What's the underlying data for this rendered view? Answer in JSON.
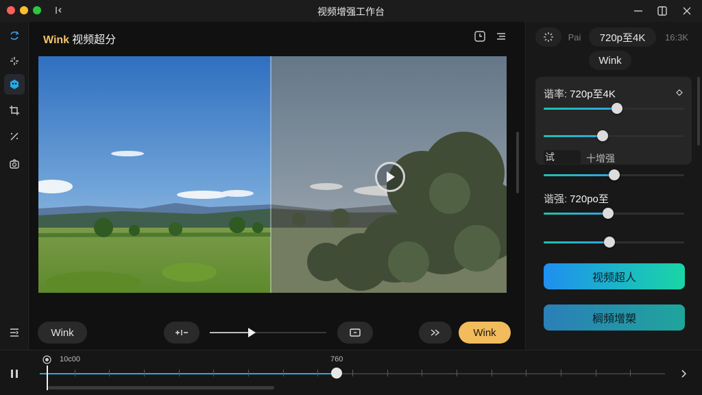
{
  "window": {
    "title": "视频增强工作台"
  },
  "preview": {
    "brand": "Wink",
    "title": "视频超分"
  },
  "controls": {
    "left_chip": "Wink",
    "zoom_label": "+|-",
    "progress_fraction": 0.36,
    "right_chip": "Wink"
  },
  "panel": {
    "chip_pro": "Pai",
    "chip_resolution": "720p至4K",
    "chip_ratio": "16:3K",
    "chip_wink": "Wink",
    "row1_label": "谐率:",
    "row1_value": "720p至4K",
    "slider1": 0.52,
    "slider2": 0.42,
    "seg_box": "试",
    "seg_text": "十增强",
    "slider3": 0.5,
    "row4_label": "谐强:",
    "row4_value": "720po至",
    "slider4": 0.46,
    "slider5": 0.47,
    "button_primary": "视频超人",
    "button_secondary": "榈頻增槊"
  },
  "timeline": {
    "start_time": "10c00",
    "marker_time": "760",
    "progress_fraction": 0.475
  },
  "colors": {
    "accent_yellow": "#f2bb5b",
    "accent_teal": "#19d6a6",
    "accent_blue": "#2aa7e0"
  }
}
